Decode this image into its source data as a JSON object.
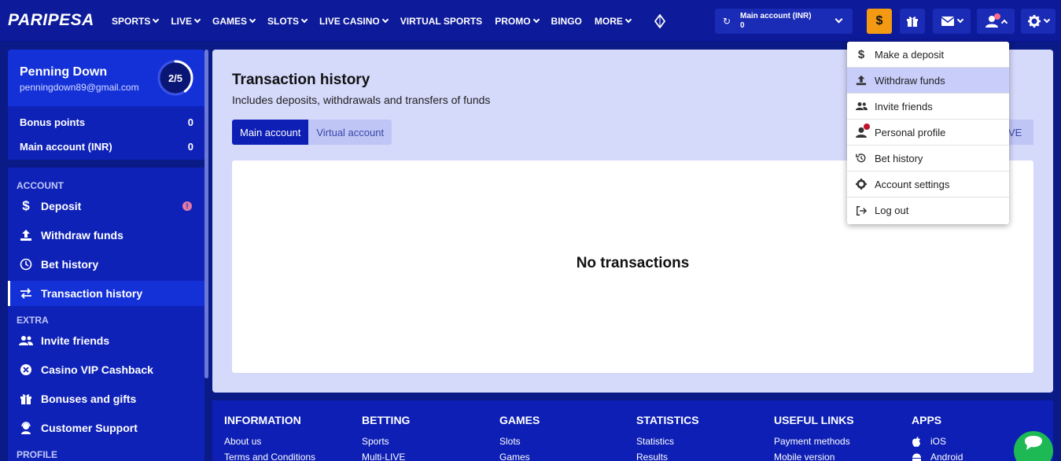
{
  "brand": "PARIPESA",
  "nav": [
    "SPORTS",
    "LIVE",
    "GAMES",
    "SLOTS",
    "LIVE CASINO",
    "VIRTUAL SPORTS",
    "PROMO",
    "BINGO",
    "MORE"
  ],
  "nav_has_chevron": [
    true,
    true,
    true,
    true,
    true,
    false,
    true,
    false,
    true
  ],
  "account_box": {
    "label": "Main account (INR)",
    "value": "0"
  },
  "deposit_symbol": "$",
  "profile": {
    "name": "Penning Down",
    "email": "penningdown89@gmail.com",
    "progress_text": "2/5",
    "progress_fraction": 0.4
  },
  "balances": [
    {
      "label": "Bonus points",
      "value": "0"
    },
    {
      "label": "Main account (INR)",
      "value": "0"
    }
  ],
  "sidebar": {
    "section_account": "ACCOUNT",
    "section_extra": "EXTRA",
    "section_profile": "PROFILE",
    "items": [
      {
        "label": "Deposit",
        "icon": "dollar-icon"
      },
      {
        "label": "Withdraw funds",
        "icon": "upload-icon"
      },
      {
        "label": "Bet history",
        "icon": "clock-icon"
      },
      {
        "label": "Transaction history",
        "icon": "transfer-icon",
        "active": true
      },
      {
        "label": "Invite friends",
        "icon": "users-icon"
      },
      {
        "label": "Casino VIP Cashback",
        "icon": "vip-icon"
      },
      {
        "label": "Bonuses and gifts",
        "icon": "gift-icon"
      },
      {
        "label": "Customer Support",
        "icon": "support-icon"
      }
    ]
  },
  "main": {
    "title": "Transaction history",
    "subtitle": "Includes deposits, withdrawals and transfers of funds",
    "tabs": [
      "Main account",
      "Virtual account"
    ],
    "partial_button": "VE",
    "empty_text": "No transactions"
  },
  "dropdown": [
    {
      "label": "Make a deposit",
      "icon": "dollar-icon"
    },
    {
      "label": "Withdraw funds",
      "icon": "upload-icon",
      "highlighted": true
    },
    {
      "label": "Invite friends",
      "icon": "users-icon"
    },
    {
      "label": "Personal profile",
      "icon": "user-icon"
    },
    {
      "label": "Bet history",
      "icon": "history-icon"
    },
    {
      "label": "Account settings",
      "icon": "gear-icon"
    },
    {
      "label": "Log out",
      "icon": "logout-icon"
    }
  ],
  "footer": [
    {
      "heading": "INFORMATION",
      "links": [
        "About us",
        "Terms and Conditions"
      ]
    },
    {
      "heading": "BETTING",
      "links": [
        "Sports",
        "Multi-LIVE"
      ]
    },
    {
      "heading": "GAMES",
      "links": [
        "Slots",
        "Games"
      ]
    },
    {
      "heading": "STATISTICS",
      "links": [
        "Statistics",
        "Results"
      ]
    },
    {
      "heading": "USEFUL LINKS",
      "links": [
        "Payment methods",
        "Mobile version"
      ]
    },
    {
      "heading": "APPS",
      "links": [
        "iOS",
        "Android"
      ]
    }
  ],
  "colors": {
    "header": "#0d1a9a",
    "accent": "#1431d8",
    "deposit": "#f39a12",
    "panel": "#d5d9fa",
    "chat": "#1db954"
  }
}
